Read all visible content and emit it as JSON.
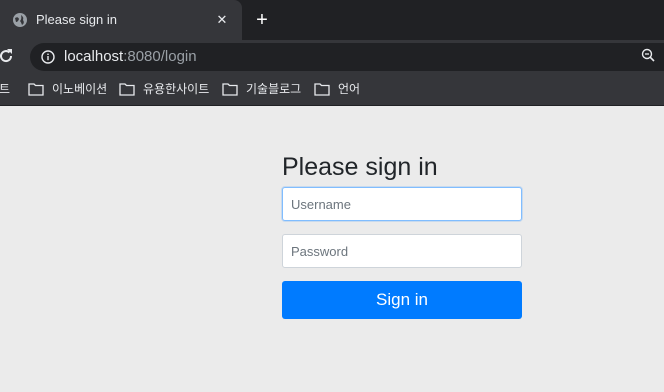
{
  "browser": {
    "tab": {
      "title": "Please sign in",
      "close_glyph": "✕",
      "favicon": "globe-icon"
    },
    "new_tab_glyph": "+",
    "address": {
      "host": "localhost",
      "rest": ":8080/login"
    },
    "bookmarks": [
      {
        "label": "트",
        "icon": "none"
      },
      {
        "label": "이노베이션",
        "icon": "folder-icon"
      },
      {
        "label": "유용한사이트",
        "icon": "folder-icon"
      },
      {
        "label": "기술블로그",
        "icon": "folder-icon"
      },
      {
        "label": "언어",
        "icon": "folder-icon"
      }
    ]
  },
  "login": {
    "heading": "Please sign in",
    "username_placeholder": "Username",
    "password_placeholder": "Password",
    "submit_label": "Sign in"
  },
  "colors": {
    "primary": "#007bff",
    "page_background": "#ebebeb",
    "chrome_dark": "#202124",
    "chrome_toolbar": "#35363a"
  }
}
